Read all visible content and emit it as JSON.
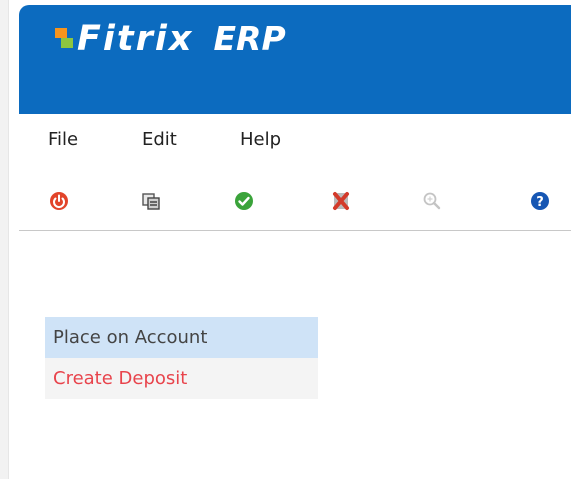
{
  "app": {
    "logo_text": "Fitrix",
    "product": "ERP",
    "brand_color": "#0c6bbf"
  },
  "menu": {
    "items": [
      {
        "label": "File"
      },
      {
        "label": "Edit"
      },
      {
        "label": "Help"
      }
    ]
  },
  "toolbar": {
    "buttons": [
      {
        "icon": "power-icon",
        "color": "#e2442a"
      },
      {
        "icon": "copy-icon",
        "color": "#555555"
      },
      {
        "icon": "check-icon",
        "color": "#3aa33a"
      },
      {
        "icon": "cancel-icon",
        "color": "#d33a2a"
      },
      {
        "icon": "zoom-icon",
        "color": "#bbbbbb"
      },
      {
        "icon": "help-icon",
        "color": "#1656b3"
      }
    ]
  },
  "list": {
    "items": [
      {
        "label": "Place on Account"
      },
      {
        "label": "Create Deposit"
      }
    ]
  }
}
